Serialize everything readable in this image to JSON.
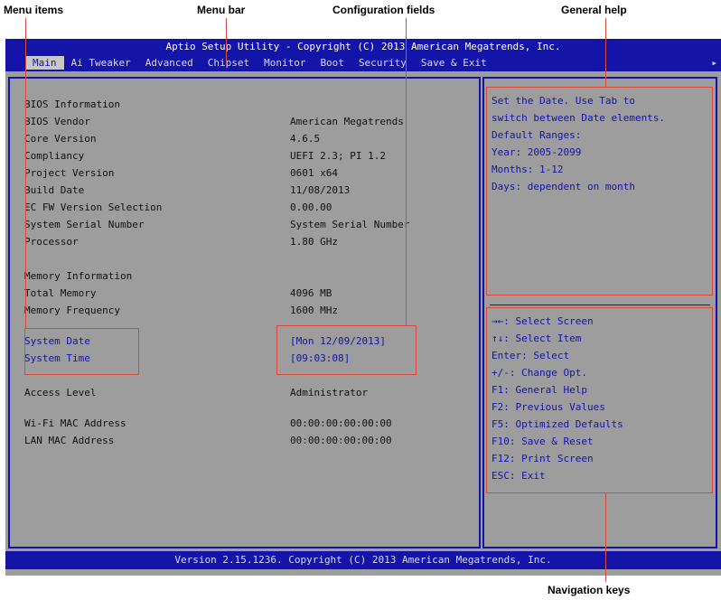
{
  "callouts": {
    "menu_items": "Menu items",
    "menu_bar": "Menu bar",
    "configuration_fields": "Configuration fields",
    "general_help": "General help",
    "navigation_keys": "Navigation keys"
  },
  "bios": {
    "title": "Aptio Setup Utility - Copyright (C) 2013 American Megatrends, Inc.",
    "menu": [
      "Main",
      "Ai Tweaker",
      "Advanced",
      "Chipset",
      "Monitor",
      "Boot",
      "Security",
      "Save & Exit"
    ],
    "main_rows": [
      {
        "label": "BIOS Information",
        "value": ""
      },
      {
        "label": "BIOS Vendor",
        "value": "American Megatrends"
      },
      {
        "label": "Core Version",
        "value": "4.6.5"
      },
      {
        "label": "Compliancy",
        "value": "UEFI 2.3; PI 1.2"
      },
      {
        "label": "Project Version",
        "value": "0601 x64"
      },
      {
        "label": "Build Date",
        "value": "11/08/2013"
      },
      {
        "label": "EC FW Version Selection",
        "value": "0.00.00"
      },
      {
        "label": "System Serial Number",
        "value": "System Serial Number"
      },
      {
        "label": "Processor",
        "value": "1.80 GHz"
      },
      {
        "label": "",
        "value": ""
      },
      {
        "label": "Memory Information",
        "value": ""
      },
      {
        "label": "Total Memory",
        "value": "4096 MB"
      },
      {
        "label": "Memory Frequency",
        "value": "1600 MHz"
      },
      {
        "label": "",
        "value": ""
      },
      {
        "label": "System Date",
        "value": "[Mon 12/09/2013]"
      },
      {
        "label": "System Time",
        "value": "[09:03:08]"
      },
      {
        "label": "",
        "value": ""
      },
      {
        "label": "Access Level",
        "value": "Administrator"
      },
      {
        "label": "",
        "value": ""
      },
      {
        "label": "Wi-Fi MAC Address",
        "value": "00:00:00:00:00:00"
      },
      {
        "label": "LAN MAC Address",
        "value": "00:00:00:00:00:00"
      }
    ],
    "general_help": [
      "Set the Date. Use Tab to",
      "switch between Date elements.",
      "Default Ranges:",
      "Year: 2005-2099",
      "Months: 1-12",
      "Days: dependent on month"
    ],
    "navigation_keys": [
      "→←: Select Screen",
      "↑↓: Select Item",
      "Enter: Select",
      "+/-: Change Opt.",
      "F1: General Help",
      "F2: Previous Values",
      "F5: Optimized Defaults",
      "F10: Save & Reset",
      "F12: Print Screen",
      "ESC: Exit"
    ],
    "status": "Version 2.15.1236. Copyright (C) 2013 American Megatrends, Inc."
  },
  "colors": {
    "bios_blue": "#1414a8",
    "panel_gray": "#9d9d9d",
    "callout_red": "#d94a3a"
  }
}
